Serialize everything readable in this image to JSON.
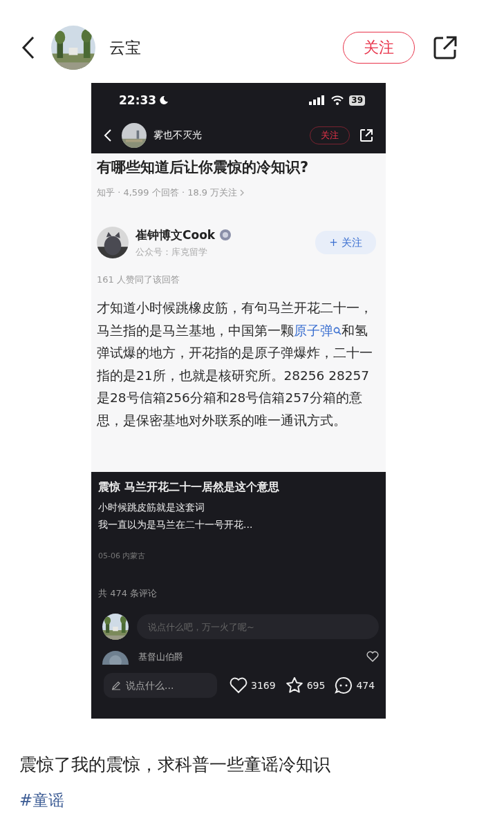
{
  "header": {
    "author": "云宝",
    "follow_label": "关注"
  },
  "screenshot": {
    "status_bar": {
      "time": "22:33",
      "battery": "39"
    },
    "nav": {
      "author": "雾也不灭光",
      "follow_label": "关注"
    },
    "question": {
      "title": "有哪些知道后让你震惊的冷知识?",
      "meta": "知乎 · 4,599 个回答 · 18.9 万关注"
    },
    "answerer": {
      "name": "崔钟博文Cook",
      "subtitle": "公众号：库克留学",
      "follow_label": "+ 关注"
    },
    "upvotes": "161 人赞同了该回答",
    "answer": {
      "before": "才知道小时候跳橡皮筋，有句马兰开花二十一，马兰指的是马兰基地，中国第一颗",
      "link": "原子弹",
      "after": "和氢弹试爆的地方，开花指的是原子弹爆炸，二十一指的是21所，也就是核研究所。28256 28257是28号信箱256分箱和28号信箱257分箱的意思，是保密基地对外联系的唯一通讯方式。"
    },
    "note": {
      "title": "震惊 马兰开花二十一居然是这个意思",
      "lines": [
        "小时候跳皮筋就是这套词",
        "我一直以为是马兰在二十一号开花..."
      ],
      "meta": "05-06 内蒙古"
    },
    "comments": {
      "count_label": "共 474 条评论",
      "input_placeholder": "说点什么吧，万一火了呢~",
      "first_commenter": "基督山伯爵"
    },
    "bottom_bar": {
      "input_placeholder": "说点什么...",
      "likes": "3169",
      "stars": "695",
      "comments": "474"
    }
  },
  "caption": "震惊了我的震惊，求科普一些童谣冷知识",
  "hashtag": "#童谣"
}
